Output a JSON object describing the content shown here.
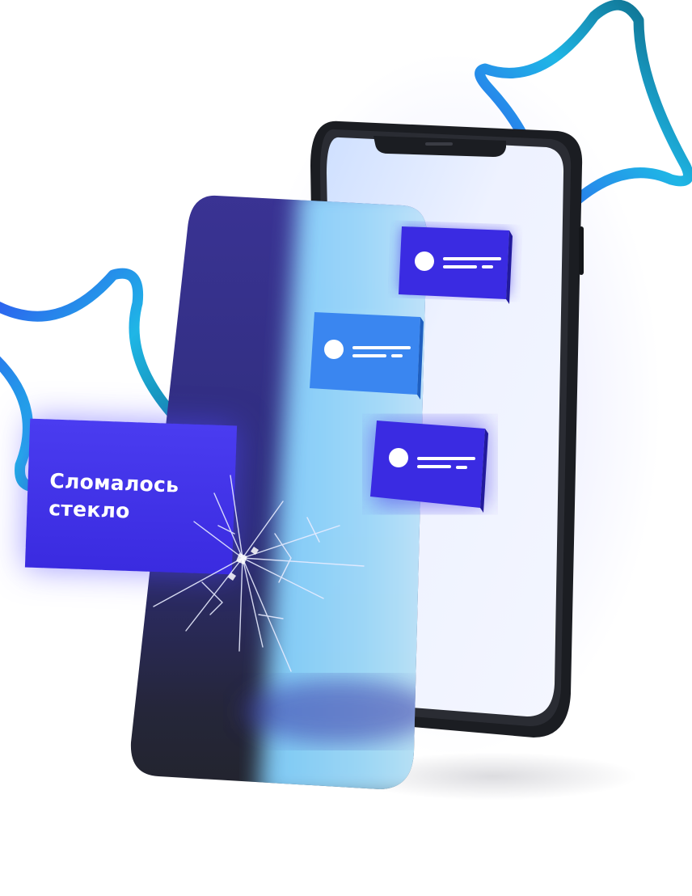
{
  "label": {
    "line1": "Сломалось",
    "line2": "стекло"
  },
  "colors": {
    "accent": "#3d2ee8",
    "accent_light": "#3a86f0",
    "phone_body": "#1b1d22",
    "screen": "#f0f4ff",
    "star_start": "#1fb6e6",
    "star_end": "#0b5f78"
  },
  "icons": [
    "star-outline-icon",
    "notification-card-icon",
    "avatar-dot-icon"
  ]
}
